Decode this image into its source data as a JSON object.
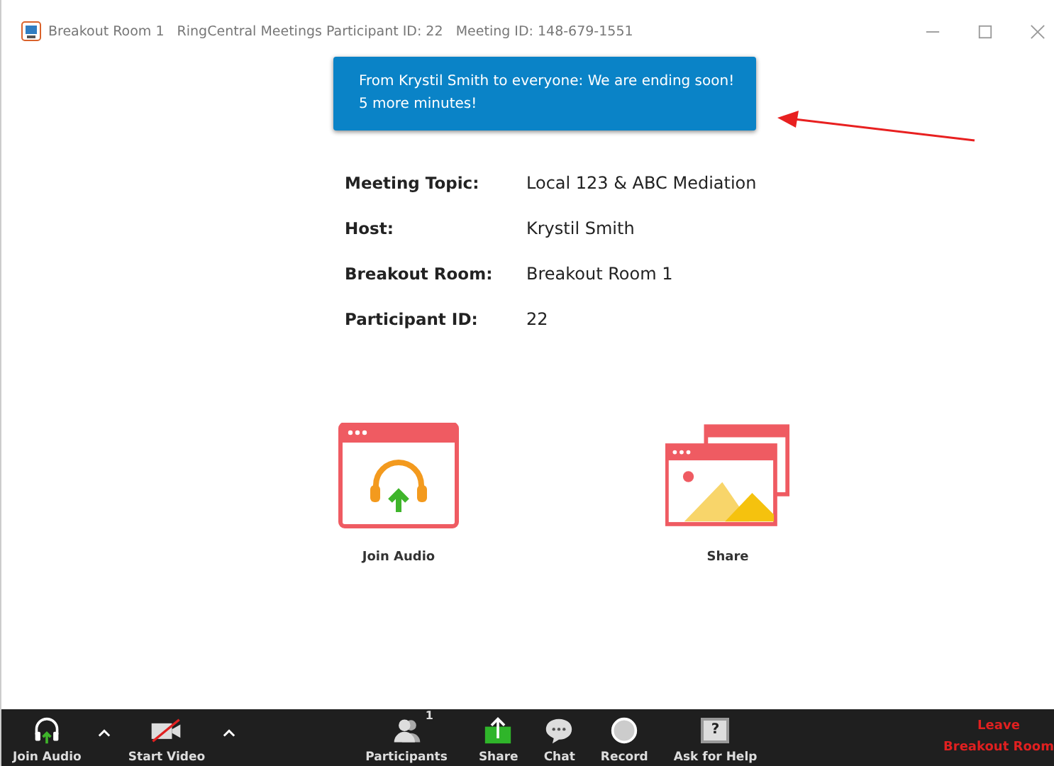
{
  "window": {
    "title": "Breakout Room 1   RingCentral Meetings Participant ID: 22   Meeting ID: 148-679-1551"
  },
  "notification": {
    "text": "From Krystil Smith to everyone: We are ending soon! 5 more minutes!"
  },
  "details": [
    {
      "label": "Meeting Topic:",
      "value": "Local 123 & ABC Mediation"
    },
    {
      "label": "Host:",
      "value": "Krystil Smith"
    },
    {
      "label": "Breakout Room:",
      "value": "Breakout Room 1"
    },
    {
      "label": "Participant ID:",
      "value": "22"
    }
  ],
  "actions": [
    {
      "kind": "audio",
      "label": "Join Audio"
    },
    {
      "kind": "share",
      "label": "Share"
    }
  ],
  "toolbar": [
    {
      "kind": "audio",
      "label": "Join Audio",
      "caret": true
    },
    {
      "kind": "video",
      "label": "Start Video",
      "caret": true
    },
    {
      "kind": "participants",
      "label": "Participants",
      "count": "1",
      "caret": false
    },
    {
      "kind": "share",
      "label": "Share",
      "caret": false
    },
    {
      "kind": "chat",
      "label": "Chat",
      "caret": false
    },
    {
      "kind": "record",
      "label": "Record",
      "caret": false
    },
    {
      "kind": "help",
      "label": "Ask for Help",
      "glyph": "?",
      "caret": false
    }
  ],
  "leave": {
    "label": "Leave Breakout Room"
  }
}
